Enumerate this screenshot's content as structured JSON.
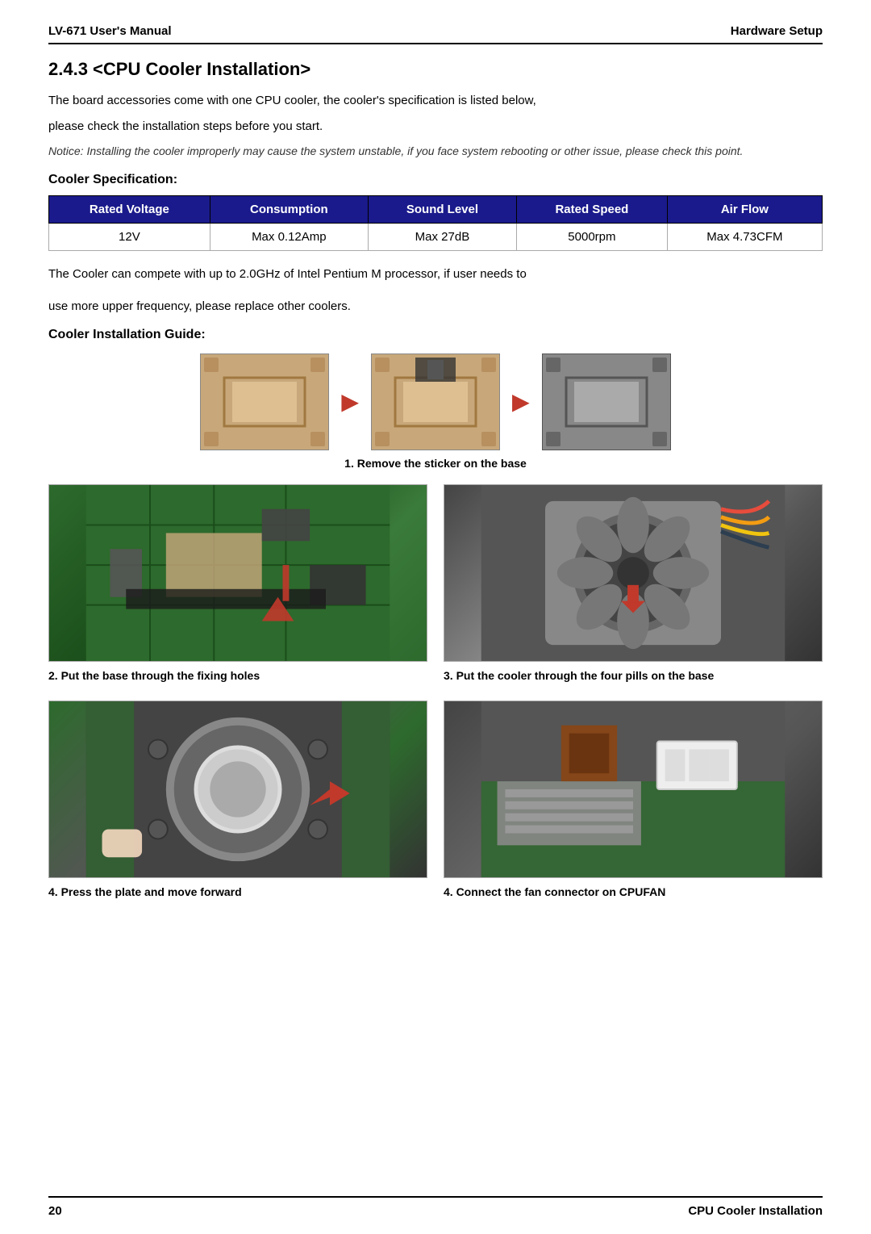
{
  "header": {
    "left": "LV-671 User's Manual",
    "right": "Hardware Setup"
  },
  "section": {
    "title": "2.4.3 <CPU Cooler Installation>",
    "intro1": "The board accessories come with one CPU cooler, the cooler's specification is listed below,",
    "intro2": "please check the installation steps before you start.",
    "notice": "Notice: Installing the cooler improperly may cause the system unstable, if you face system rebooting or other issue, please check this point.",
    "spec_title": "Cooler Specification:",
    "table": {
      "headers": [
        "Rated Voltage",
        "Consumption",
        "Sound Level",
        "Rated Speed",
        "Air Flow"
      ],
      "row": [
        "12V",
        "Max 0.12Amp",
        "Max 27dB",
        "5000rpm",
        "Max 4.73CFM"
      ]
    },
    "body1": "The Cooler can compete with up to 2.0GHz of Intel Pentium M processor, if user needs to",
    "body2": "use more upper frequency, please replace other coolers.",
    "install_title": "Cooler Installation Guide:",
    "step1_caption": "1. Remove the sticker on the base",
    "step2_caption": "2. Put the base through the fixing holes",
    "step3_caption": "3. Put the cooler through the four pills on the base",
    "step4_caption": "4. Press the plate and move forward",
    "step5_caption": "4. Connect the fan connector on CPUFAN"
  },
  "footer": {
    "left": "20",
    "right": "CPU  Cooler  Installation"
  }
}
